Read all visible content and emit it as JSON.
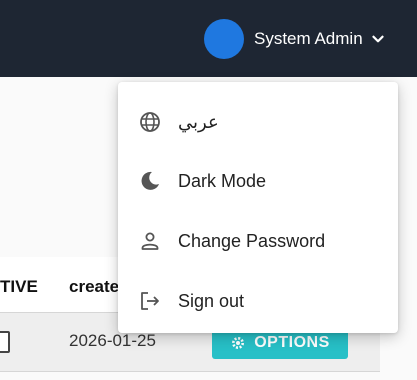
{
  "header": {
    "user_name": "System Admin"
  },
  "table": {
    "columns": [
      "TIVE",
      "create"
    ],
    "rows": [
      {
        "date": "2026-01-25",
        "options_label": "OPTIONS"
      }
    ]
  },
  "user_dropdown": {
    "items": [
      {
        "label": "عربي",
        "icon": "globe-icon"
      },
      {
        "label": "Dark Mode",
        "icon": "moon-icon"
      },
      {
        "label": "Change Password",
        "icon": "person-icon"
      },
      {
        "label": "Sign out",
        "icon": "logout-icon"
      }
    ]
  },
  "colors": {
    "topbar": "#1e2633",
    "avatar": "#1f78e0",
    "options_button": "#27c0c7"
  }
}
